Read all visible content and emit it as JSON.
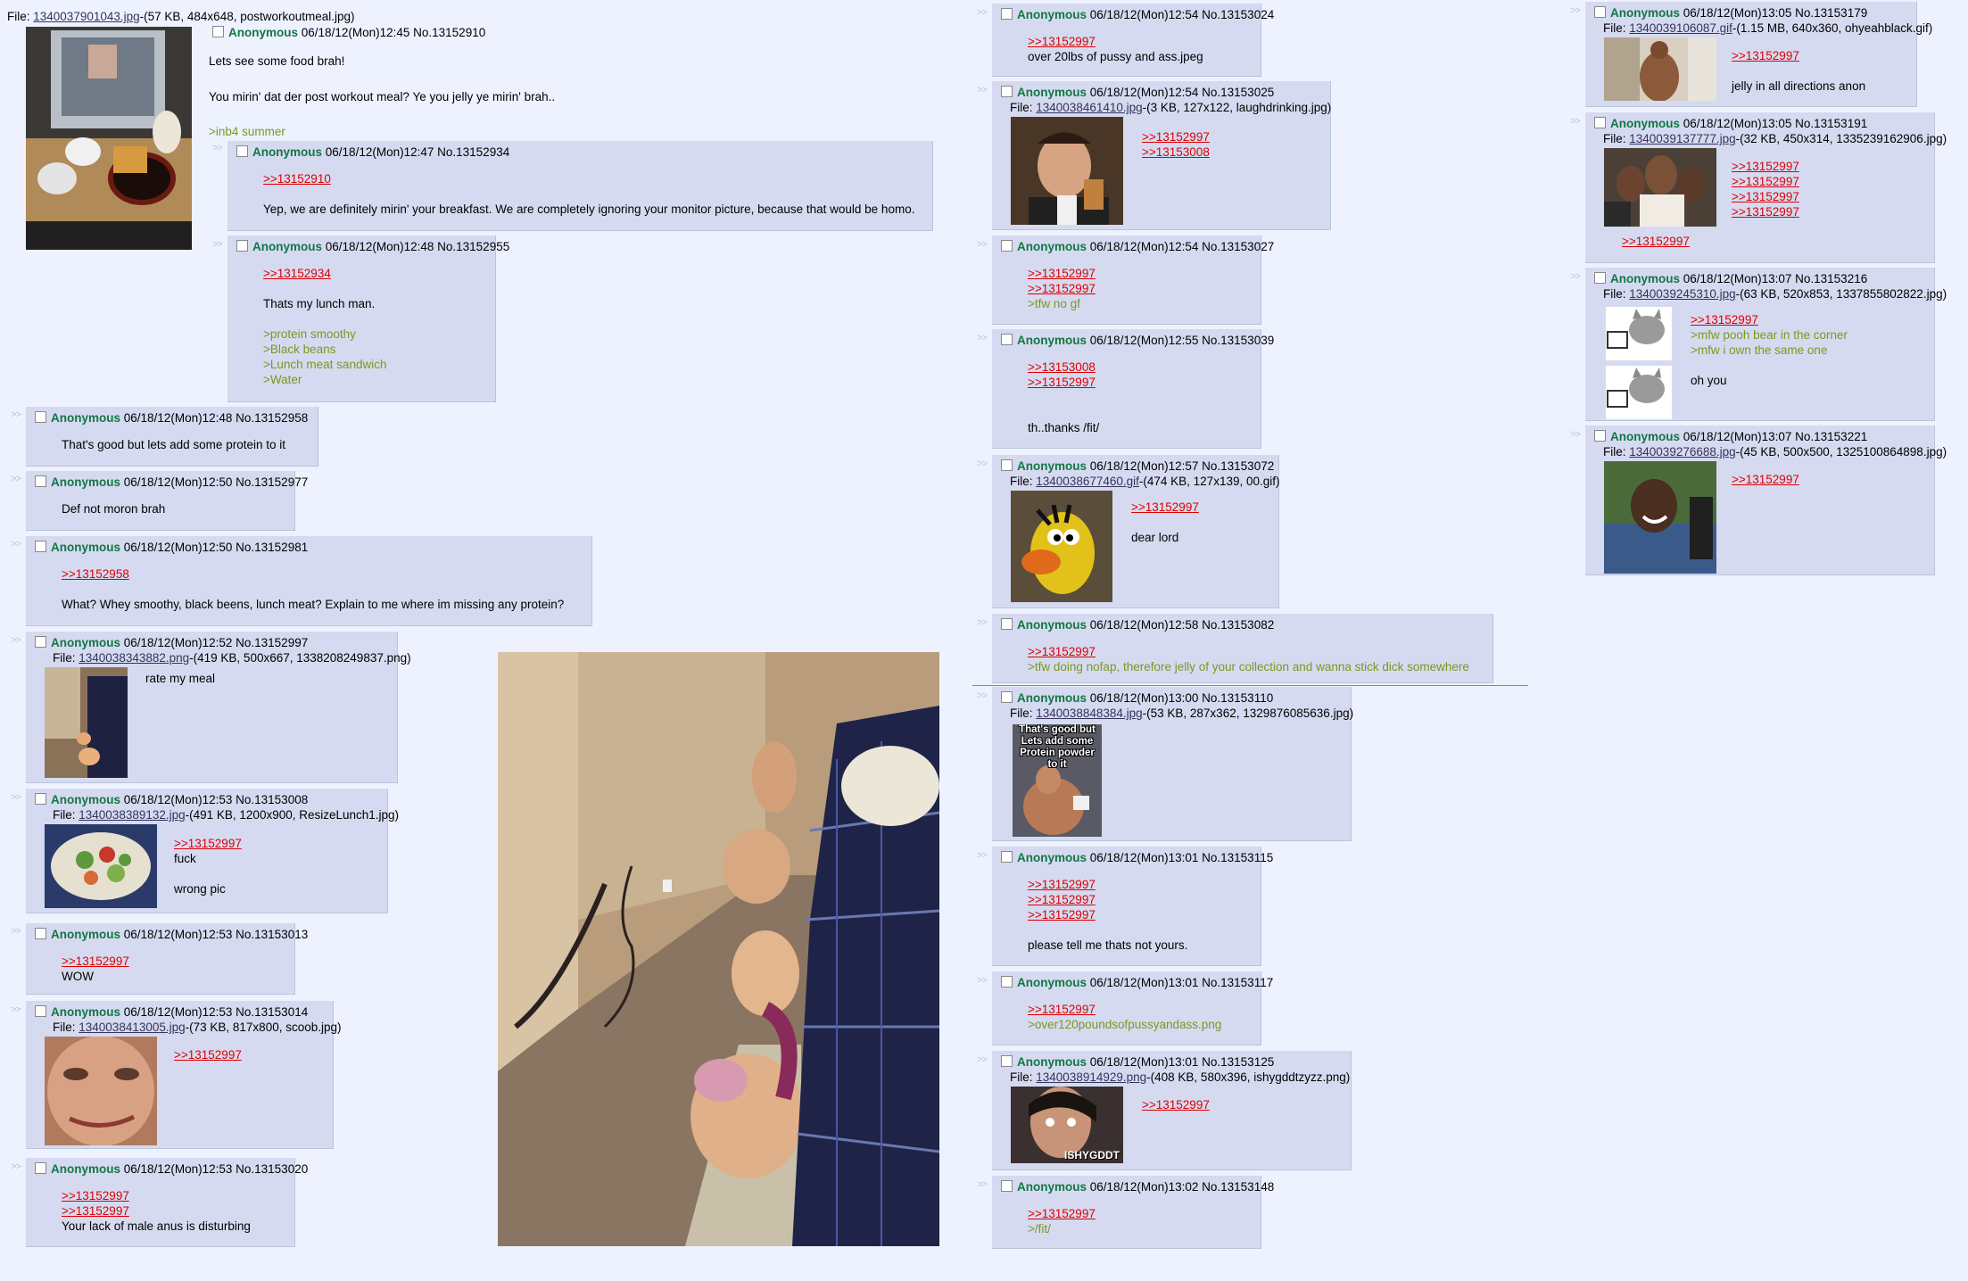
{
  "op": {
    "file_link": "1340037901043.jpg",
    "file_meta": "-(57 KB, 484x648, postworkoutmeal.jpg)",
    "file_prefix": "File: ",
    "name": "Anonymous",
    "date": "06/18/12(Mon)12:45",
    "postno": "No.13152910",
    "lines": [
      "Lets see some food brah!",
      "You mirin' dat der post workout meal? Ye you jelly ye mirin' brah..",
      ">inb4 summer"
    ]
  },
  "posts": {
    "p13152934": {
      "name": "Anonymous",
      "date": "06/18/12(Mon)12:47",
      "postno": "No.13152934",
      "quote": ">>13152910",
      "text": "Yep, we are definitely mirin' your breakfast. We are completely ignoring your monitor picture, because that would be homo."
    },
    "p13152955": {
      "name": "Anonymous",
      "date": "06/18/12(Mon)12:48",
      "postno": "No.13152955",
      "quote": ">>13152934",
      "text": "Thats my lunch man.",
      "green": [
        ">protein smoothy",
        ">Black beans",
        ">Lunch meat sandwich",
        ">Water"
      ]
    },
    "p13152958": {
      "name": "Anonymous",
      "date": "06/18/12(Mon)12:48",
      "postno": "No.13152958",
      "text": "That's good but lets add some protein to it"
    },
    "p13152977": {
      "name": "Anonymous",
      "date": "06/18/12(Mon)12:50",
      "postno": "No.13152977",
      "text": "Def not moron brah"
    },
    "p13152981": {
      "name": "Anonymous",
      "date": "06/18/12(Mon)12:50",
      "postno": "No.13152981",
      "quote": ">>13152958",
      "text": "What? Whey smoothy, black beens, lunch meat? Explain to me where im missing any protein?"
    },
    "p13152997": {
      "name": "Anonymous",
      "date": "06/18/12(Mon)12:52",
      "postno": "No.13152997",
      "file_link": "1340038343882.png",
      "file_meta": "-(419 KB, 500x667, 1338208249837.png)",
      "text": "rate my meal"
    },
    "p13153008": {
      "name": "Anonymous",
      "date": "06/18/12(Mon)12:53",
      "postno": "No.13153008",
      "file_link": "1340038389132.jpg",
      "file_meta": "-(491 KB, 1200x900, ResizeLunch1.jpg)",
      "quote": ">>13152997",
      "text": "fuck",
      "text2": "wrong pic"
    },
    "p13153013": {
      "name": "Anonymous",
      "date": "06/18/12(Mon)12:53",
      "postno": "No.13153013",
      "quote": ">>13152997",
      "text": "WOW"
    },
    "p13153014": {
      "name": "Anonymous",
      "date": "06/18/12(Mon)12:53",
      "postno": "No.13153014",
      "file_link": "1340038413005.jpg",
      "file_meta": "-(73 KB, 817x800, scoob.jpg)",
      "quote": ">>13152997"
    },
    "p13153020": {
      "name": "Anonymous",
      "date": "06/18/12(Mon)12:53",
      "postno": "No.13153020",
      "quote": ">>13152997",
      "quote2": ">>13152997",
      "text": "Your lack of male anus is disturbing"
    },
    "p13153024": {
      "name": "Anonymous",
      "date": "06/18/12(Mon)12:54",
      "postno": "No.13153024",
      "quote": ">>13152997",
      "text": "over 20lbs of pussy and ass.jpeg"
    },
    "p13153025": {
      "name": "Anonymous",
      "date": "06/18/12(Mon)12:54",
      "postno": "No.13153025",
      "file_link": "1340038461410.jpg",
      "file_meta": "-(3 KB, 127x122, laughdrinking.jpg)",
      "quote": ">>13152997",
      "quote2": ">>13153008"
    },
    "p13153027": {
      "name": "Anonymous",
      "date": "06/18/12(Mon)12:54",
      "postno": "No.13153027",
      "quote": ">>13152997",
      "quote2": ">>13152997",
      "green": [
        ">tfw no gf"
      ]
    },
    "p13153039": {
      "name": "Anonymous",
      "date": "06/18/12(Mon)12:55",
      "postno": "No.13153039",
      "quote": ">>13153008",
      "quote2": ">>13152997",
      "text": "th..thanks /fit/"
    },
    "p13153072": {
      "name": "Anonymous",
      "date": "06/18/12(Mon)12:57",
      "postno": "No.13153072",
      "file_link": "1340038677460.gif",
      "file_meta": "-(474 KB, 127x139, 00.gif)",
      "quote": ">>13152997",
      "text": "dear lord"
    },
    "p13153082": {
      "name": "Anonymous",
      "date": "06/18/12(Mon)12:58",
      "postno": "No.13153082",
      "quote": ">>13152997",
      "green": [
        ">tfw doing nofap, therefore jelly of your collection and wanna stick dick somewhere"
      ]
    },
    "p13153110": {
      "name": "Anonymous",
      "date": "06/18/12(Mon)13:00",
      "postno": "No.13153110",
      "file_link": "1340038848384.jpg",
      "file_meta": "-(53 KB, 287x362, 1329876085636.jpg)",
      "caption": "That's good but Lets add some Protein powder to it"
    },
    "p13153115": {
      "name": "Anonymous",
      "date": "06/18/12(Mon)13:01",
      "postno": "No.13153115",
      "quote": ">>13152997",
      "quote2": ">>13152997",
      "quote3": ">>13152997",
      "text": "please tell me thats not yours."
    },
    "p13153117": {
      "name": "Anonymous",
      "date": "06/18/12(Mon)13:01",
      "postno": "No.13153117",
      "quote": ">>13152997",
      "green": [
        ">over120poundsofpussyandass.png"
      ]
    },
    "p13153125": {
      "name": "Anonymous",
      "date": "06/18/12(Mon)13:01",
      "postno": "No.13153125",
      "file_link": "1340038914929.png",
      "file_meta": "-(408 KB, 580x396, ishygddtzyzz.png)",
      "quote": ">>13152997",
      "caption": "ISHYGDDT"
    },
    "p13153148": {
      "name": "Anonymous",
      "date": "06/18/12(Mon)13:02",
      "postno": "No.13153148",
      "quote": ">>13152997",
      "green": [
        ">/fit/"
      ]
    },
    "p13153179": {
      "name": "Anonymous",
      "date": "06/18/12(Mon)13:05",
      "postno": "No.13153179",
      "file_link": "1340039106087.gif",
      "file_meta": "-(1.15 MB, 640x360, ohyeahblack.gif)",
      "quote": ">>13152997",
      "text": "jelly in all directions anon"
    },
    "p13153191": {
      "name": "Anonymous",
      "date": "06/18/12(Mon)13:05",
      "postno": "No.13153191",
      "file_link": "1340039137777.jpg",
      "file_meta": "-(32 KB, 450x314, 1335239162906.jpg)",
      "quote": ">>13152997",
      "quote2": ">>13152997",
      "quote3": ">>13152997",
      "quote4": ">>13152997",
      "quote5": ">>13152997"
    },
    "p13153216": {
      "name": "Anonymous",
      "date": "06/18/12(Mon)13:07",
      "postno": "No.13153216",
      "file_link": "1340039245310.jpg",
      "file_meta": "-(63 KB, 520x853, 1337855802822.jpg)",
      "quote": ">>13152997",
      "green": [
        ">mfw pooh bear in the corner",
        ">mfw i own the same one"
      ],
      "text": "oh you"
    },
    "p13153221": {
      "name": "Anonymous",
      "date": "06/18/12(Mon)13:07",
      "postno": "No.13153221",
      "file_link": "1340039276688.jpg",
      "file_meta": "-(45 KB, 500x500, 1325100864898.jpg)",
      "quote": ">>13152997"
    }
  },
  "labels": {
    "file_prefix": "File: ",
    "arrows": ">>"
  },
  "colors": {
    "background": "#eef2ff",
    "post_bg": "#d6daf0",
    "name": "#117743",
    "quote": "#dd0000",
    "greentext": "#789922"
  }
}
